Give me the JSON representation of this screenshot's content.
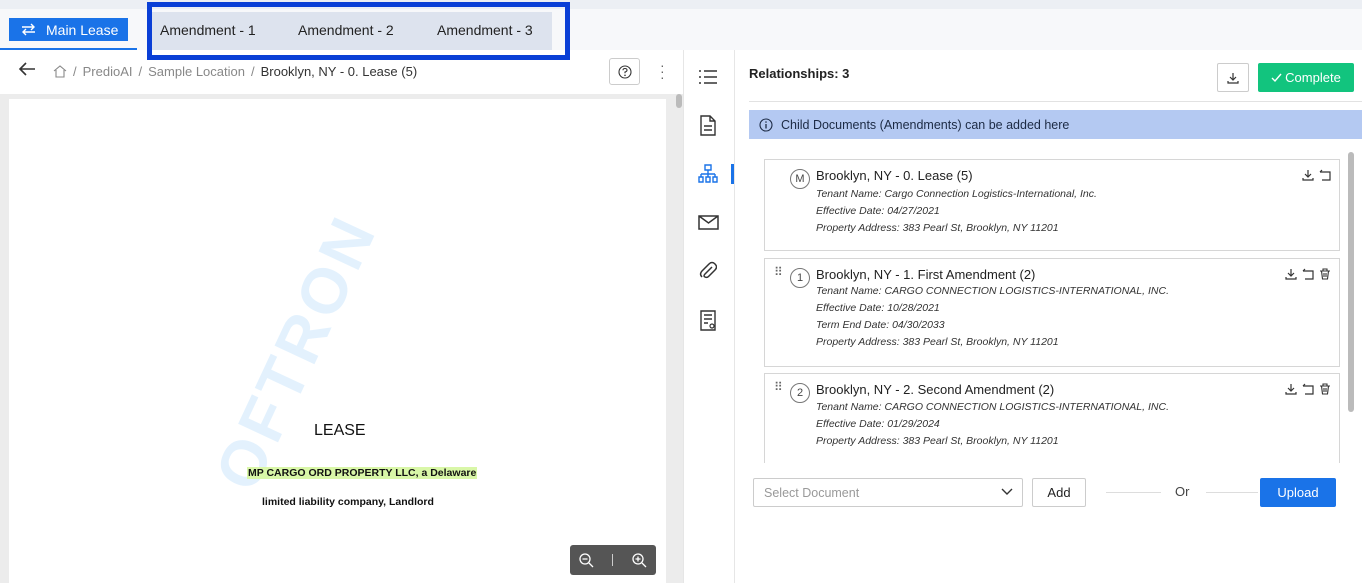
{
  "tabs": {
    "main_label": "Main Lease",
    "amendments": [
      "Amendment - 1",
      "Amendment - 2",
      "Amendment - 3"
    ]
  },
  "breadcrumb": {
    "items": [
      "PredioAI",
      "Sample Location"
    ],
    "separator": "/",
    "current": "Brooklyn, NY - 0. Lease (5)"
  },
  "document": {
    "title": "LEASE",
    "line1": "MP CARGO ORD PROPERTY LLC, a Delaware",
    "line2": "limited liability company, Landlord",
    "watermark": "OFTRON"
  },
  "zoom": {
    "zoom_out_icon": "zoom-out-icon",
    "zoom_in_icon": "zoom-in-icon"
  },
  "rail": {
    "icons": [
      "list-icon",
      "document-icon",
      "hierarchy-icon",
      "mail-icon",
      "paperclip-icon",
      "form-icon"
    ],
    "active": "hierarchy-icon"
  },
  "relationships": {
    "title": "Relationships: 3",
    "complete_label": "Complete",
    "info": "Child Documents (Amendments) can be added here",
    "cards": [
      {
        "badge": "M",
        "title": "Brooklyn, NY - 0. Lease (5)",
        "meta": [
          "Tenant Name: Cargo Connection Logistics-International, Inc.",
          "Effective Date: 04/27/2021",
          "Property Address: 383 Pearl St, Brooklyn, NY 11201"
        ]
      },
      {
        "badge": "1",
        "title": "Brooklyn, NY - 1. First Amendment (2)",
        "meta": [
          "Tenant Name: CARGO CONNECTION LOGISTICS-INTERNATIONAL, INC.",
          "Effective Date: 10/28/2021",
          "Term End Date: 04/30/2033",
          "Property Address: 383 Pearl St, Brooklyn, NY 11201"
        ]
      },
      {
        "badge": "2",
        "title": "Brooklyn, NY - 2. Second Amendment (2)",
        "meta": [
          "Tenant Name: CARGO CONNECTION LOGISTICS-INTERNATIONAL, INC.",
          "Effective Date: 01/29/2024",
          "Property Address: 383 Pearl St, Brooklyn, NY 11201"
        ]
      }
    ]
  },
  "footer": {
    "select_placeholder": "Select Document",
    "add_label": "Add",
    "or_label": "Or",
    "upload_label": "Upload"
  },
  "colors": {
    "primary": "#1a73e8",
    "complete": "#12c47e",
    "banner": "#b4c9f2",
    "highlight": "#0a3fd6"
  }
}
